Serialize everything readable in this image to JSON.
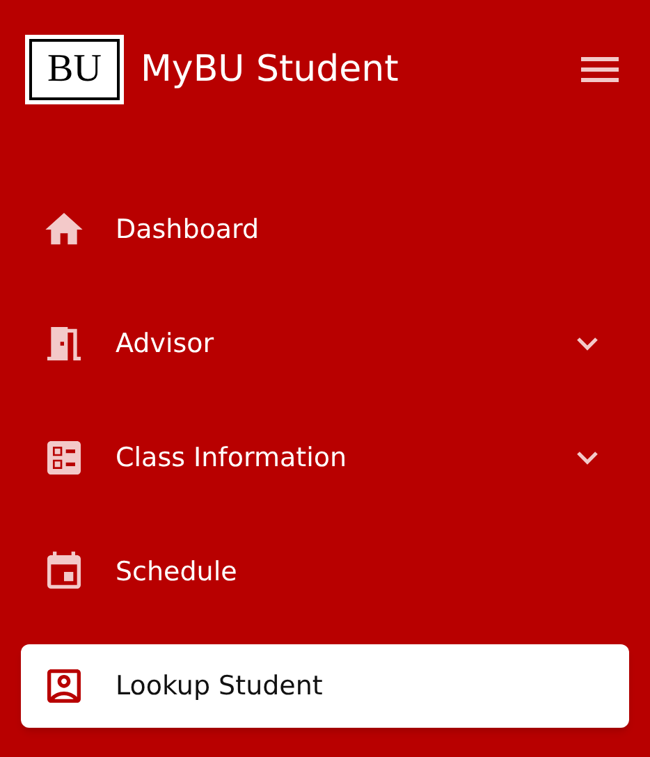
{
  "header": {
    "logo": "BU",
    "title": "MyBU Student"
  },
  "nav": [
    {
      "label": "Dashboard",
      "expandable": false,
      "selected": false
    },
    {
      "label": "Advisor",
      "expandable": true,
      "selected": false
    },
    {
      "label": "Class Information",
      "expandable": true,
      "selected": false
    },
    {
      "label": "Schedule",
      "expandable": false,
      "selected": false
    },
    {
      "label": "Lookup Student",
      "expandable": false,
      "selected": true
    }
  ]
}
